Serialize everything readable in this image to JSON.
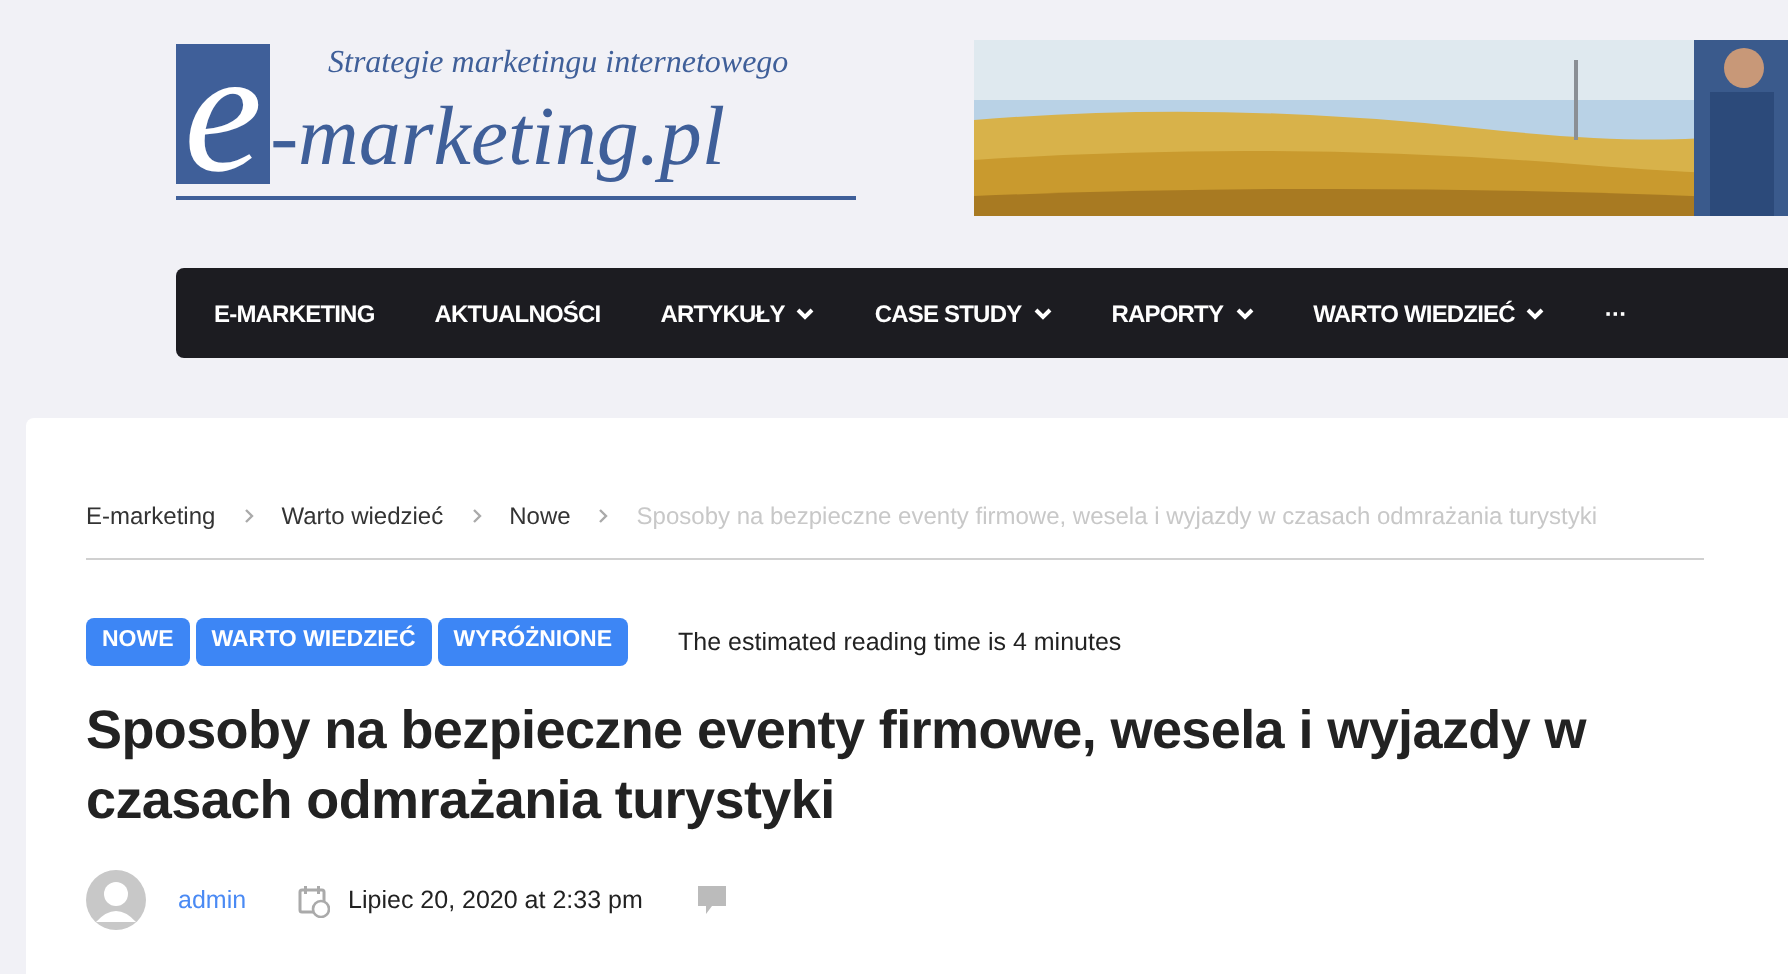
{
  "logo": {
    "letter": "e",
    "name": "-marketing.pl",
    "tagline": "Strategie marketingu internetowego"
  },
  "banner": {
    "kind": "picture"
  },
  "nav": [
    {
      "label": "E-MARKETING",
      "dropdown": false
    },
    {
      "label": "AKTUALNOŚCI",
      "dropdown": false
    },
    {
      "label": "ARTYKUŁY",
      "dropdown": true
    },
    {
      "label": "CASE STUDY",
      "dropdown": true
    },
    {
      "label": "RAPORTY",
      "dropdown": true
    },
    {
      "label": "WARTO WIEDZIEĆ",
      "dropdown": true
    },
    {
      "label": "···",
      "dropdown": false
    }
  ],
  "breadcrumbs": [
    {
      "label": "E-marketing",
      "current": false
    },
    {
      "label": "Warto wiedzieć",
      "current": false
    },
    {
      "label": "Nowe",
      "current": false
    },
    {
      "label": "Sposoby na bezpieczne eventy firmowe, wesela i wyjazdy w czasach odmrażania turystyki",
      "current": true
    }
  ],
  "tags": [
    "NOWE",
    "WARTO WIEDZIEĆ",
    "WYRÓŻNIONE"
  ],
  "reading_time": "The estimated reading time is 4 minutes",
  "title": "Sposoby na bezpieczne eventy firmowe, wesela i wyjazdy w czasach odmrażania turystyki",
  "meta": {
    "author": "admin",
    "date": "Lipiec 20, 2020 at 2:33 pm"
  }
}
